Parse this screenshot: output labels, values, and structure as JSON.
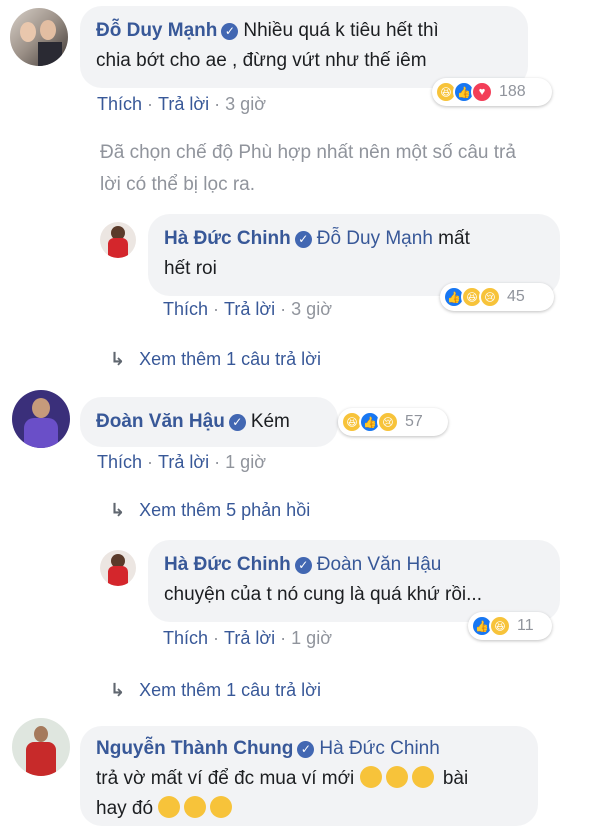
{
  "comments": [
    {
      "author": "Đỗ Duy Mạnh",
      "text_line1": "Nhiều quá k tiêu hết thì",
      "text_line2": "chia bớt cho ae , đừng vứt như thế iêm",
      "like_label": "Thích",
      "reply_label": "Trả lời",
      "time": "3 giờ",
      "reactions": [
        "haha-icon",
        "like-icon",
        "love-icon"
      ],
      "reaction_count": "188"
    },
    {
      "author": "Hà Đức Chinh",
      "mention": "Đỗ Duy Mạnh",
      "text_after_mention": "mất",
      "text_line2": "hết roi",
      "like_label": "Thích",
      "reply_label": "Trả lời",
      "time": "3 giờ",
      "reactions": [
        "like-icon",
        "haha-icon",
        "sad-icon"
      ],
      "reaction_count": "45"
    },
    {
      "author": "Đoàn Văn Hậu",
      "text": "Kém",
      "like_label": "Thích",
      "reply_label": "Trả lời",
      "time": "1 giờ",
      "reactions": [
        "haha-icon",
        "like-icon",
        "sad-icon"
      ],
      "reaction_count": "57"
    },
    {
      "author": "Hà Đức Chinh",
      "mention": "Đoàn Văn Hậu",
      "text_line2": "chuyện của t nó cung là quá khứ rồi...",
      "like_label": "Thích",
      "reply_label": "Trả lời",
      "time": "1 giờ",
      "reactions": [
        "like-icon",
        "haha-icon"
      ],
      "reaction_count": "11"
    },
    {
      "author": "Nguyễn Thành Chung",
      "mention": "Hà Đức Chinh",
      "text_line2_pre": "trả vờ mất ví để đc mua ví mới",
      "text_line2_post": "bài",
      "text_line3": "hay đó"
    }
  ],
  "filter_note_line1": "Đã chọn chế độ Phù hợp nhất nên một số câu trả",
  "filter_note_line2": "lời có thể bị lọc ra.",
  "view_more_1": "Xem thêm 1 câu trả lời",
  "view_more_5": "Xem thêm 5 phản hồi",
  "view_more_1b": "Xem thêm 1 câu trả lời",
  "separator": "·",
  "verified_mark": "✓",
  "colors": {
    "link": "#385898",
    "muted": "#90949c",
    "bubble": "#f2f3f5",
    "like": "#1877f2",
    "love": "#f33e58",
    "haha": "#f7c33a"
  }
}
